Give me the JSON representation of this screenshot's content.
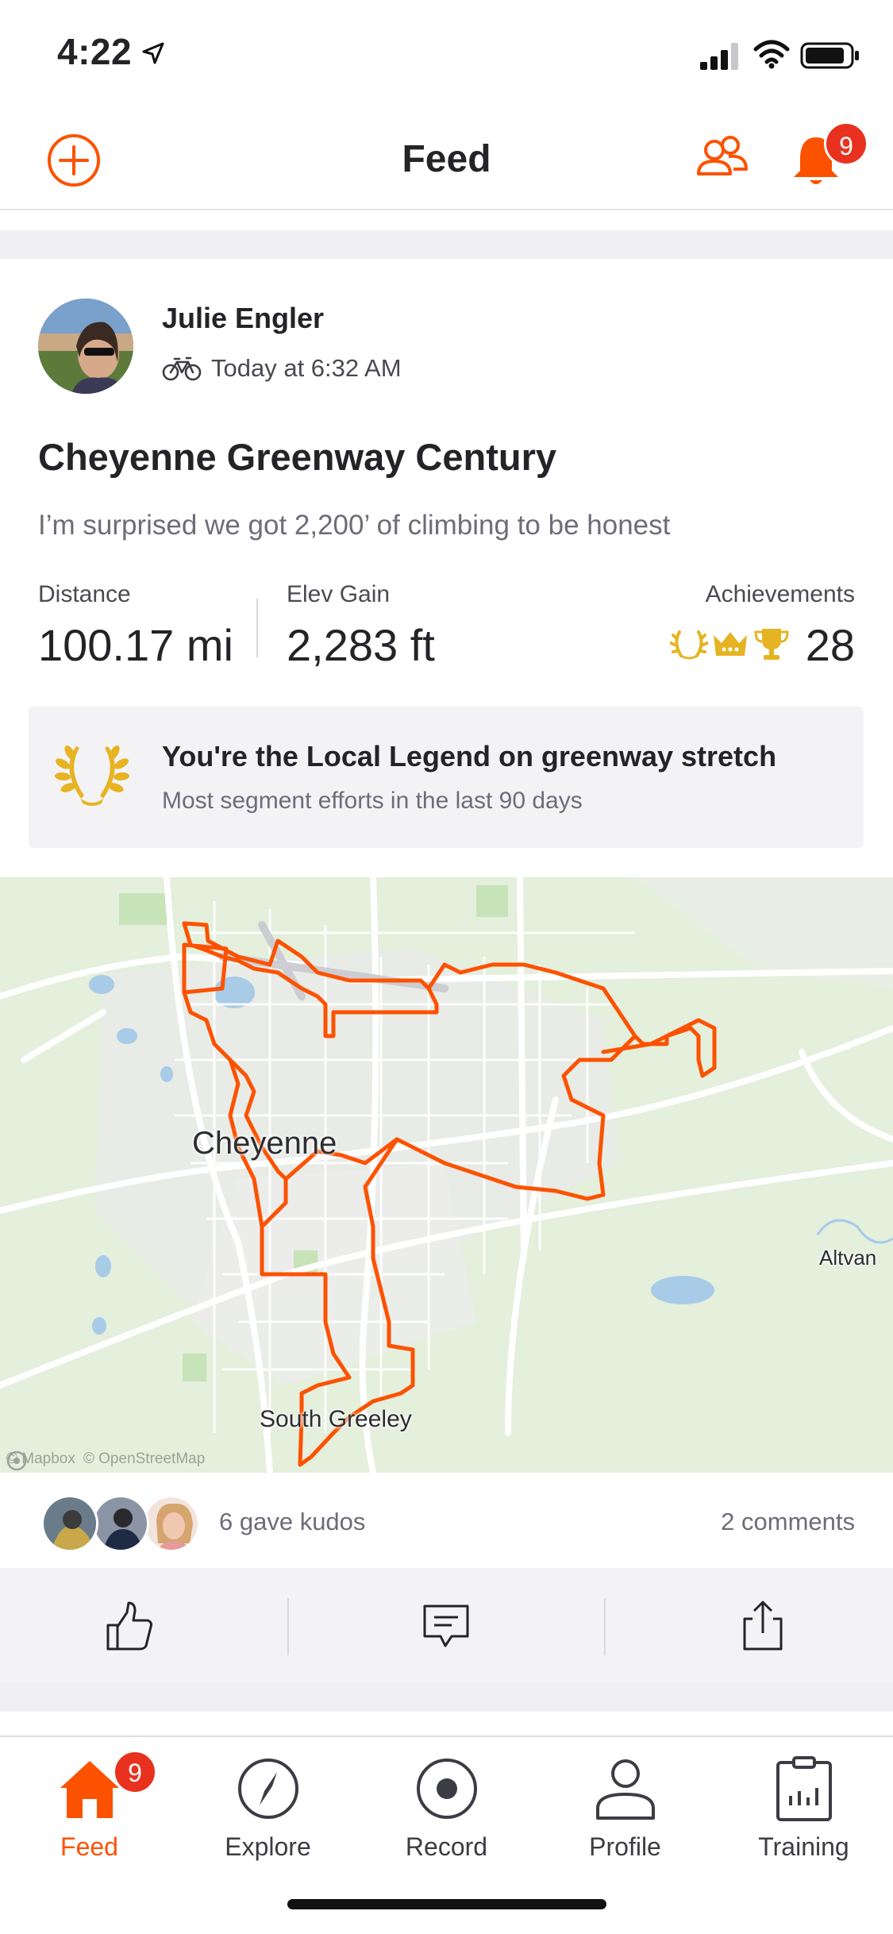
{
  "status_bar": {
    "time": "4:22"
  },
  "header": {
    "title": "Feed",
    "notification_count": "9"
  },
  "activity": {
    "athlete_name": "Julie Engler",
    "timestamp": "Today at 6:32 AM",
    "title": "Cheyenne Greenway Century",
    "description": "I’m surprised we got 2,200’ of climbing to be honest",
    "stats": {
      "distance_label": "Distance",
      "distance_value": "100.17 mi",
      "elev_label": "Elev Gain",
      "elev_value": "2,283 ft",
      "achievements_label": "Achievements",
      "achievements_value": "28"
    },
    "legend": {
      "title": "You're the Local Legend on greenway stretch",
      "subtitle": "Most segment efforts in the last 90 days"
    },
    "map": {
      "labels": {
        "city": "Cheyenne",
        "town_east": "Altvan",
        "town_south": "South Greeley"
      },
      "credit_mapbox": "© Mapbox",
      "credit_osm": "© OpenStreetMap",
      "route_color": "#fc5200"
    },
    "kudos_text": "6 gave kudos",
    "comments_text": "2 comments"
  },
  "tabs": [
    {
      "label": "Feed",
      "icon": "home-icon",
      "badge": "9"
    },
    {
      "label": "Explore",
      "icon": "compass-icon"
    },
    {
      "label": "Record",
      "icon": "record-icon"
    },
    {
      "label": "Profile",
      "icon": "person-icon"
    },
    {
      "label": "Training",
      "icon": "clipboard-chart-icon"
    }
  ],
  "colors": {
    "accent": "#fc5200",
    "badge": "#e8321f",
    "gold": "#e6b422"
  }
}
